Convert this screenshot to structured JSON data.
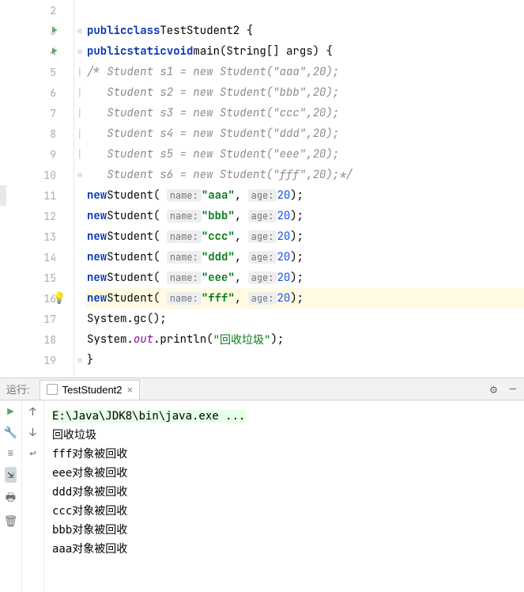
{
  "gutter": {
    "lines": [
      "2",
      "3",
      "4",
      "5",
      "6",
      "7",
      "8",
      "9",
      "10",
      "11",
      "12",
      "13",
      "14",
      "15",
      "16",
      "17",
      "18",
      "19"
    ]
  },
  "code": {
    "l3": {
      "kw1": "public",
      "kw2": "class",
      "name": "TestStudent2",
      "brace": " {"
    },
    "l4": {
      "kw1": "public",
      "kw2": "static",
      "kw3": "void",
      "fn": "main",
      "params": "(String[] args) {"
    },
    "l5": {
      "text": "/* Student s1 = new Student(\"aaa\",20);"
    },
    "l6": {
      "text": "   Student s2 = new Student(\"bbb\",20);"
    },
    "l7": {
      "text": "   Student s3 = new Student(\"ccc\",20);"
    },
    "l8": {
      "text": "   Student s4 = new Student(\"ddd\",20);"
    },
    "l9": {
      "text": "   Student s5 = new Student(\"eee\",20);"
    },
    "l10": {
      "text": "   Student s6 = new Student(\"fff\",20);*/"
    },
    "new": "new",
    "student": "Student",
    "hint_name": "name:",
    "hint_age": "age:",
    "paren_open": "( ",
    "comma": ", ",
    "paren_close": ");",
    "l11": {
      "str": "\"aaa\"",
      "num": "20"
    },
    "l12": {
      "str": "\"bbb\"",
      "num": "20"
    },
    "l13": {
      "str": "\"ccc\"",
      "num": "20"
    },
    "l14": {
      "str": "\"ddd\"",
      "num": "20"
    },
    "l15": {
      "str": "\"eee\"",
      "num": "20"
    },
    "l16": {
      "str": "\"fff\"",
      "num": "20"
    },
    "l17": {
      "text": "System.gc();"
    },
    "l18": {
      "sys": "System.",
      "out": "out",
      "print": ".println(",
      "str": "\"回收垃圾\"",
      "end": ");"
    },
    "l19": {
      "brace": "}"
    }
  },
  "panel": {
    "title": "运行:",
    "tab": "TestStudent2"
  },
  "console": {
    "cmd": "E:\\Java\\JDK8\\bin\\java.exe ...",
    "lines": [
      "回收垃圾",
      "fff对象被回收",
      "eee对象被回收",
      "ddd对象被回收",
      "ccc对象被回收",
      "bbb对象被回收",
      "aaa对象被回收"
    ]
  }
}
